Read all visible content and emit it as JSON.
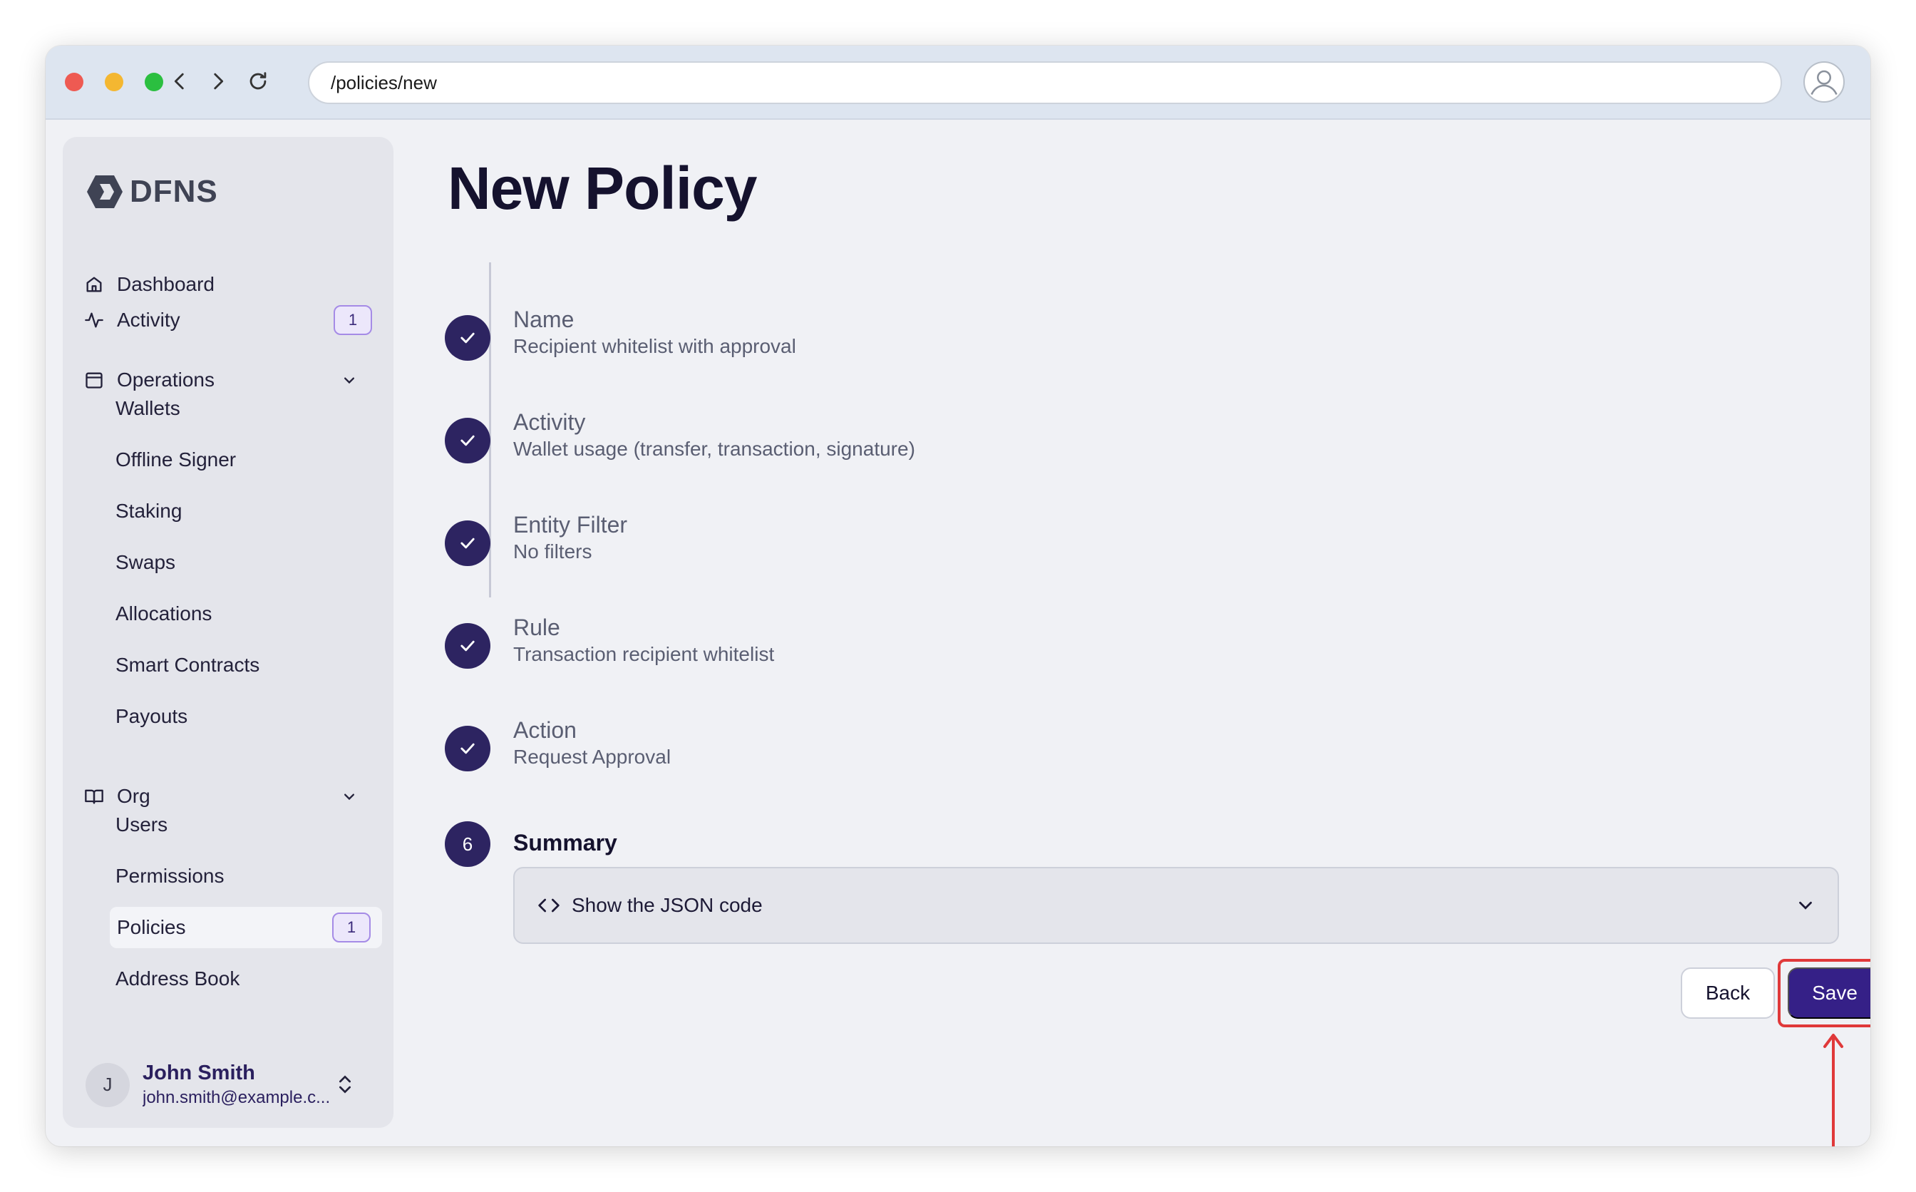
{
  "browser": {
    "url": "/policies/new"
  },
  "sidebar": {
    "brand": "DFNS",
    "dashboard": "Dashboard",
    "activity": {
      "label": "Activity",
      "badge": "1"
    },
    "operations": {
      "label": "Operations",
      "items": [
        "Wallets",
        "Offline Signer",
        "Staking",
        "Swaps",
        "Allocations",
        "Smart Contracts",
        "Payouts"
      ]
    },
    "org": {
      "label": "Org",
      "items": [
        {
          "label": "Users"
        },
        {
          "label": "Permissions"
        },
        {
          "label": "Policies",
          "badge": "1",
          "active": true
        },
        {
          "label": "Address Book"
        }
      ]
    },
    "user": {
      "initial": "J",
      "name": "John Smith",
      "email": "john.smith@example.c..."
    }
  },
  "main": {
    "title": "New Policy",
    "steps": [
      {
        "title": "Name",
        "value": "Recipient whitelist with approval",
        "done": true
      },
      {
        "title": "Activity",
        "value": "Wallet usage (transfer, transaction, signature)",
        "done": true
      },
      {
        "title": "Entity Filter",
        "value": "No filters",
        "done": true
      },
      {
        "title": "Rule",
        "value": "Transaction recipient whitelist",
        "done": true
      },
      {
        "title": "Action",
        "value": "Request Approval",
        "done": true
      },
      {
        "title": "Summary",
        "number": "6",
        "done": false
      }
    ],
    "json_toggle": "Show the JSON code",
    "back_label": "Back",
    "save_label": "Save"
  },
  "colors": {
    "accent": "#352087",
    "step_circle": "#2d2461",
    "highlight": "#e0393a"
  }
}
